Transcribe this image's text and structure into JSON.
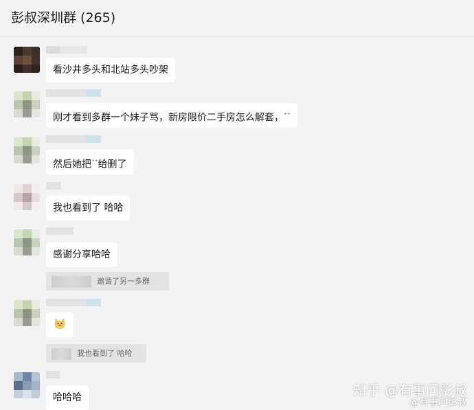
{
  "header": {
    "title": "彭叔深圳群 (265)"
  },
  "messages": [
    {
      "text": "看沙井多头和北站多头吵架"
    },
    {
      "text": "刚才看到多群一个妹子骂，新房限价二手房怎么解套，"
    },
    {
      "text": "然后她把",
      "text_after": "给删了"
    },
    {
      "text": "我也看到了 哈哈"
    },
    {
      "text": "感谢分享哈哈"
    },
    {
      "system": "邀请了另一多群"
    },
    {
      "sticker": "doge-emoji"
    },
    {
      "system": "我也看到了 哈哈"
    },
    {
      "text": "哈哈哈"
    }
  ],
  "watermark": {
    "text": "知乎 @有事问彭叔",
    "weibo": "@有事问彭叔"
  },
  "colors": {
    "background": "#f3f3f3",
    "bubble": "#ffffff",
    "system_pill": "#e3e3e3"
  }
}
